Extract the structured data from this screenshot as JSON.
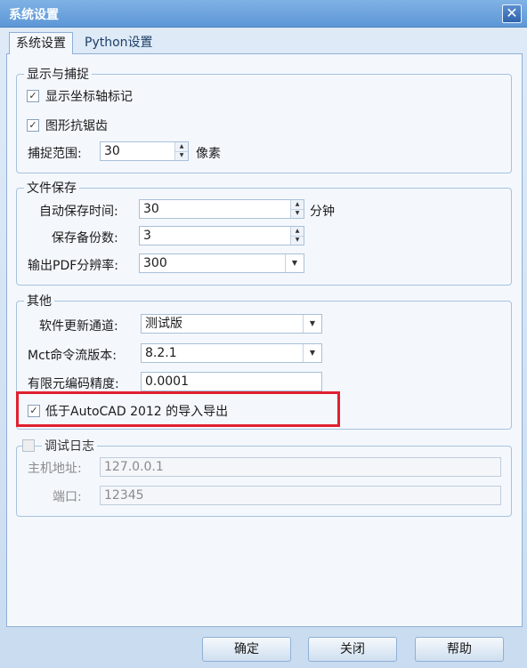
{
  "window": {
    "title": "系统设置",
    "close_glyph": "✕"
  },
  "tabs": [
    {
      "label": "系统设置",
      "active": true
    },
    {
      "label": "Python设置",
      "active": false
    }
  ],
  "display": {
    "legend": "显示与捕捉",
    "show_axis": {
      "label": "显示坐标轴标记",
      "checked": true
    },
    "antialias": {
      "label": "图形抗锯齿",
      "checked": true
    },
    "snap": {
      "label": "捕捉范围:",
      "value": "30",
      "unit": "像素"
    }
  },
  "file_save": {
    "legend": "文件保存",
    "autosave": {
      "label": "自动保存时间:",
      "value": "30",
      "unit": "分钟"
    },
    "backups": {
      "label": "保存备份数:",
      "value": "3"
    },
    "pdf_res": {
      "label": "输出PDF分辨率:",
      "value": "300"
    }
  },
  "other": {
    "legend": "其他",
    "channel": {
      "label": "软件更新通道:",
      "value": "测试版"
    },
    "mct": {
      "label": "Mct命令流版本:",
      "value": "8.2.1"
    },
    "fem": {
      "label": "有限元编码精度:",
      "value": "0.0001"
    },
    "autocad": {
      "label": "低于AutoCAD 2012 的导入导出",
      "checked": true
    }
  },
  "debug": {
    "legend": "调试日志",
    "enabled": false,
    "host": {
      "label": "主机地址:",
      "value": "127.0.0.1"
    },
    "port": {
      "label": "端口:",
      "value": "12345"
    }
  },
  "buttons": {
    "ok": "确定",
    "close": "关闭",
    "help": "帮助"
  },
  "colors": {
    "highlight": "#e02030",
    "titlebar": "#5d97d6"
  }
}
